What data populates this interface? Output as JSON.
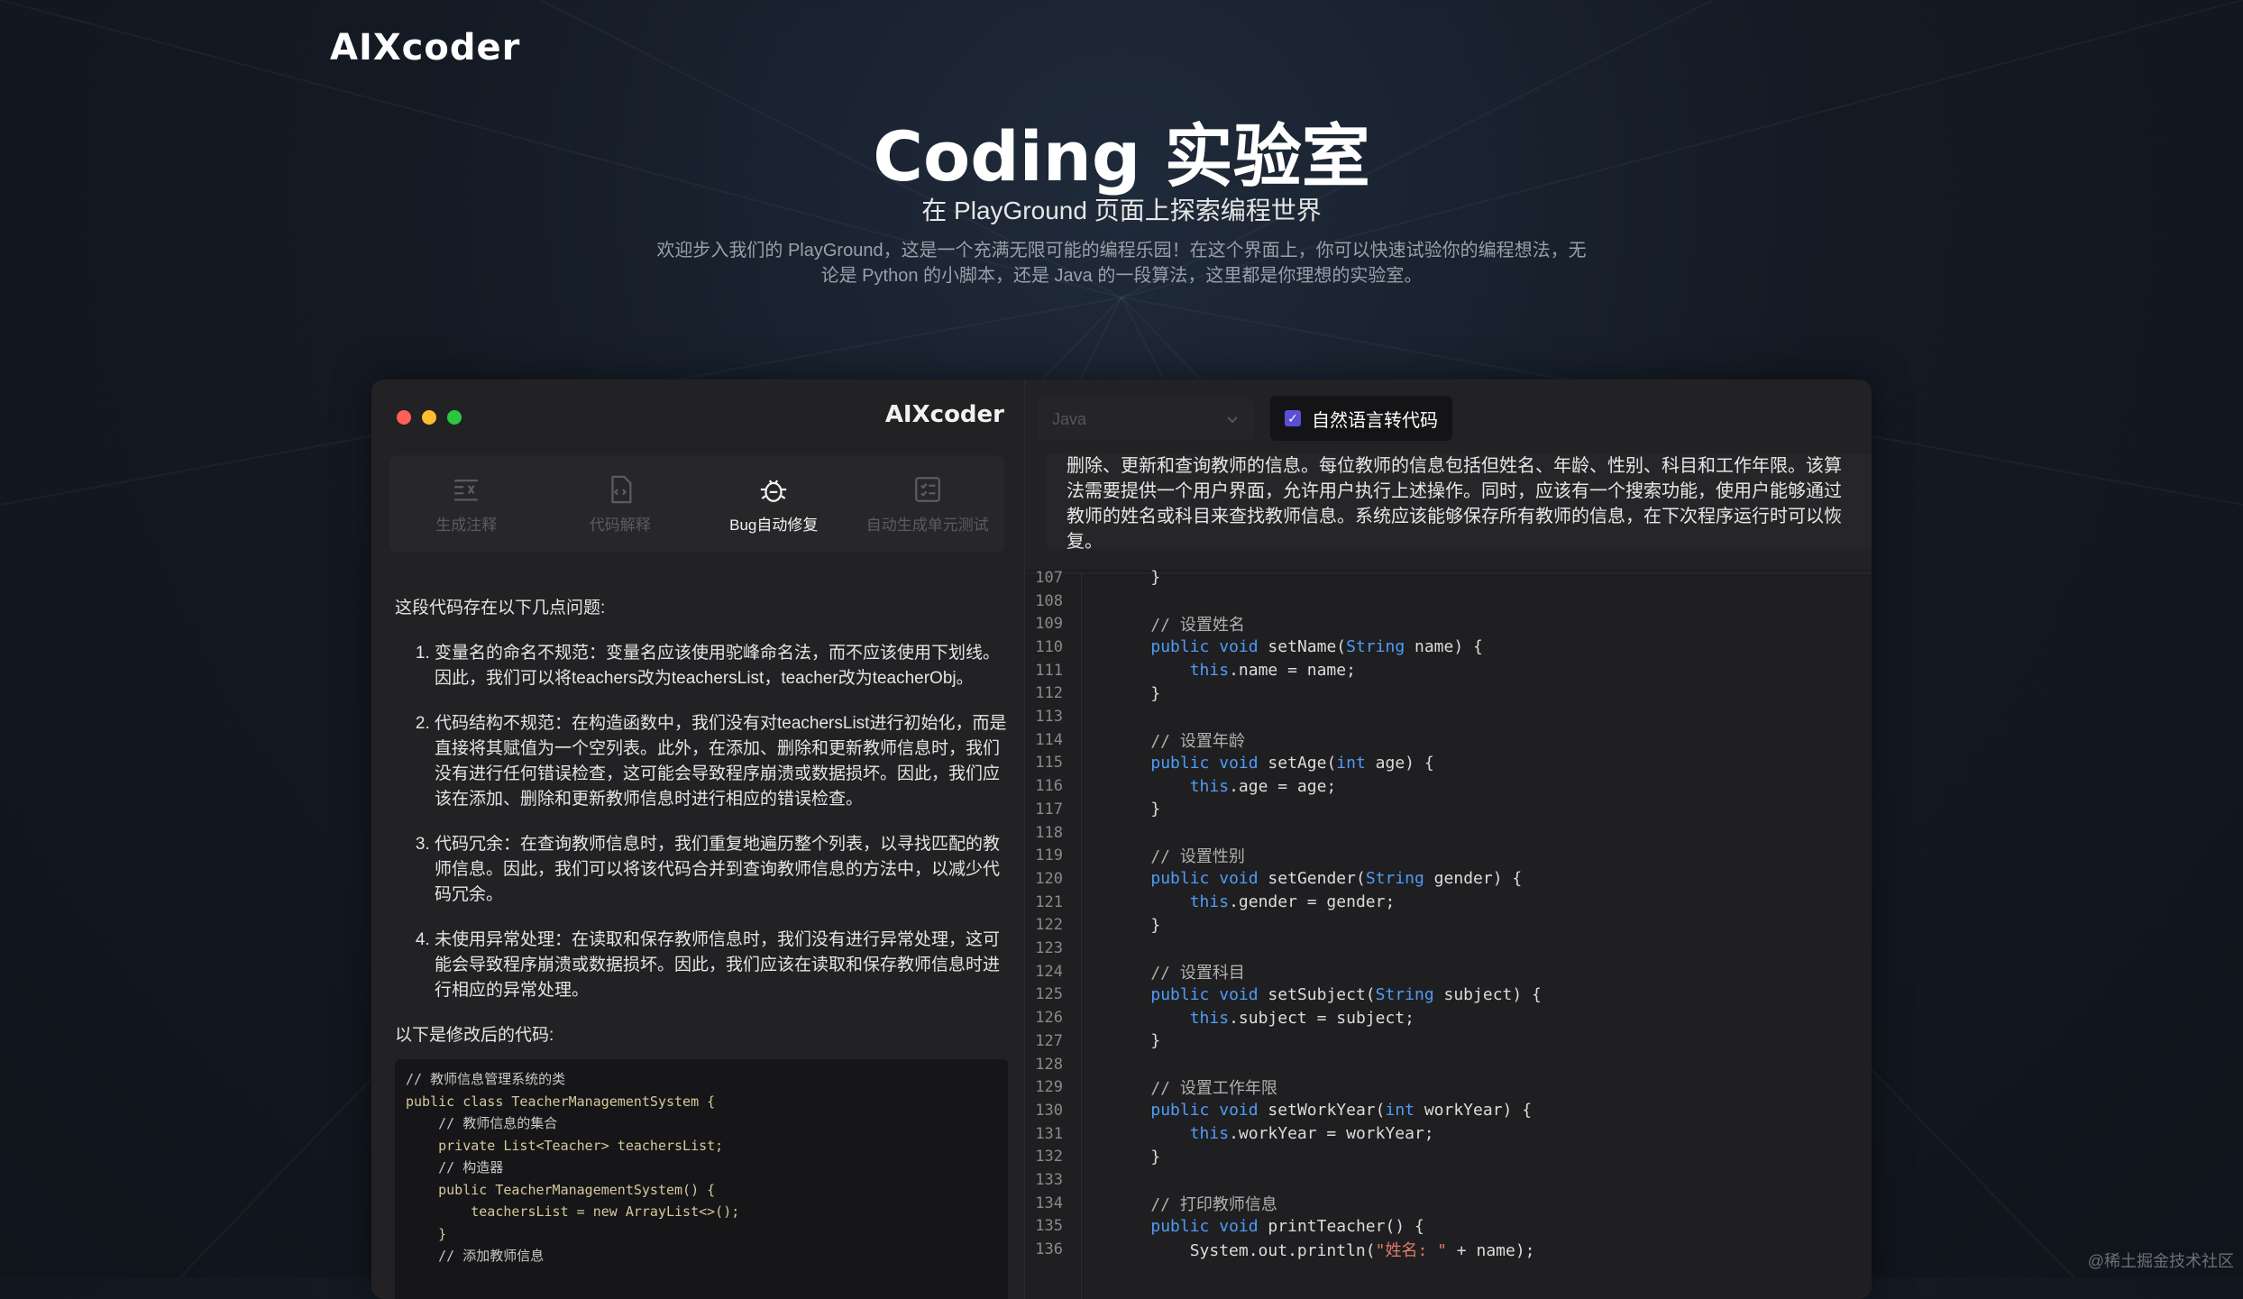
{
  "brand": {
    "logo": "AIXcoder"
  },
  "hero": {
    "title": "Coding 实验室",
    "subtitle": "在 PlayGround 页面上探索编程世界",
    "description": "欢迎步入我们的 PlayGround，这是一个充满无限可能的编程乐园！在这个界面上，你可以快速试验你的编程想法，无论是 Python 的小脚本，还是 Java 的一段算法，这里都是你理想的实验室。"
  },
  "app": {
    "logo": "AIXcoder",
    "tabs": [
      {
        "label": "生成注释",
        "icon": "comment-lines-icon",
        "active": false
      },
      {
        "label": "代码解释",
        "icon": "code-file-icon",
        "active": false
      },
      {
        "label": "Bug自动修复",
        "icon": "bug-icon",
        "active": true
      },
      {
        "label": "自动生成单元测试",
        "icon": "checklist-icon",
        "active": false
      }
    ],
    "result": {
      "intro": "这段代码存在以下几点问题:",
      "issues": [
        "变量名的命名不规范：变量名应该使用驼峰命名法，而不应该使用下划线。因此，我们可以将teachers改为teachersList，teacher改为teacherObj。",
        "代码结构不规范：在构造函数中，我们没有对teachersList进行初始化，而是直接将其赋值为一个空列表。此外，在添加、删除和更新教师信息时，我们没有进行任何错误检查，这可能会导致程序崩溃或数据损坏。因此，我们应该在添加、删除和更新教师信息时进行相应的错误检查。",
        "代码冗余：在查询教师信息时，我们重复地遍历整个列表，以寻找匹配的教师信息。因此，我们可以将该代码合并到查询教师信息的方法中，以减少代码冗余。",
        "未使用异常处理：在读取和保存教师信息时，我们没有进行异常处理，这可能会导致程序崩溃或数据损坏。因此，我们应该在读取和保存教师信息时进行相应的异常处理。"
      ],
      "code_intro": "以下是修改后的代码:",
      "code_lines": [
        "// 教师信息管理系统的类",
        "public class TeacherManagementSystem {",
        "    // 教师信息的集合",
        "    private List<Teacher> teachersList;",
        "",
        "    // 构造器",
        "    public TeacherManagementSystem() {",
        "        teachersList = new ArrayList<>();",
        "    }",
        "",
        "    // 添加教师信息"
      ]
    },
    "language_select": {
      "value": "Java"
    },
    "nl_toggle": {
      "label": "自然语言转代码",
      "checked": true
    },
    "nl_prompt": "删除、更新和查询教师的信息。每位教师的信息包括但姓名、年龄、性别、科目和工作年限。该算法需要提供一个用户界面，允许用户执行上述操作。同时，应该有一个搜索功能，使用户能够通过教师的姓名或科目来查找教师信息。系统应该能够保存所有教师的信息，在下次程序运行时可以恢复。",
    "editor": {
      "line_numbers": [
        "107",
        "108",
        "109",
        "110",
        "111",
        "112",
        "113",
        "114",
        "115",
        "116",
        "117",
        "118",
        "119",
        "120",
        "121",
        "122",
        "123",
        "124",
        "125",
        "126",
        "127",
        "128",
        "129",
        "130",
        "131",
        "132",
        "133",
        "134",
        "135",
        "136"
      ],
      "lines": [
        "    }",
        "",
        "    // 设置姓名",
        "    public void setName(String name) {",
        "        this.name = name;",
        "    }",
        "",
        "    // 设置年龄",
        "    public void setAge(int age) {",
        "        this.age = age;",
        "    }",
        "",
        "    // 设置性别",
        "    public void setGender(String gender) {",
        "        this.gender = gender;",
        "    }",
        "",
        "    // 设置科目",
        "    public void setSubject(String subject) {",
        "        this.subject = subject;",
        "    }",
        "",
        "    // 设置工作年限",
        "    public void setWorkYear(int workYear) {",
        "        this.workYear = workYear;",
        "    }",
        "",
        "    // 打印教师信息",
        "    public void printTeacher() {",
        "        System.out.println(\"姓名: \" + name);"
      ]
    }
  },
  "watermark": "@稀土掘金技术社区",
  "colors": {
    "accent": "#5b4fd6",
    "keyword": "#4f9cf7",
    "string": "#e07a6a"
  }
}
